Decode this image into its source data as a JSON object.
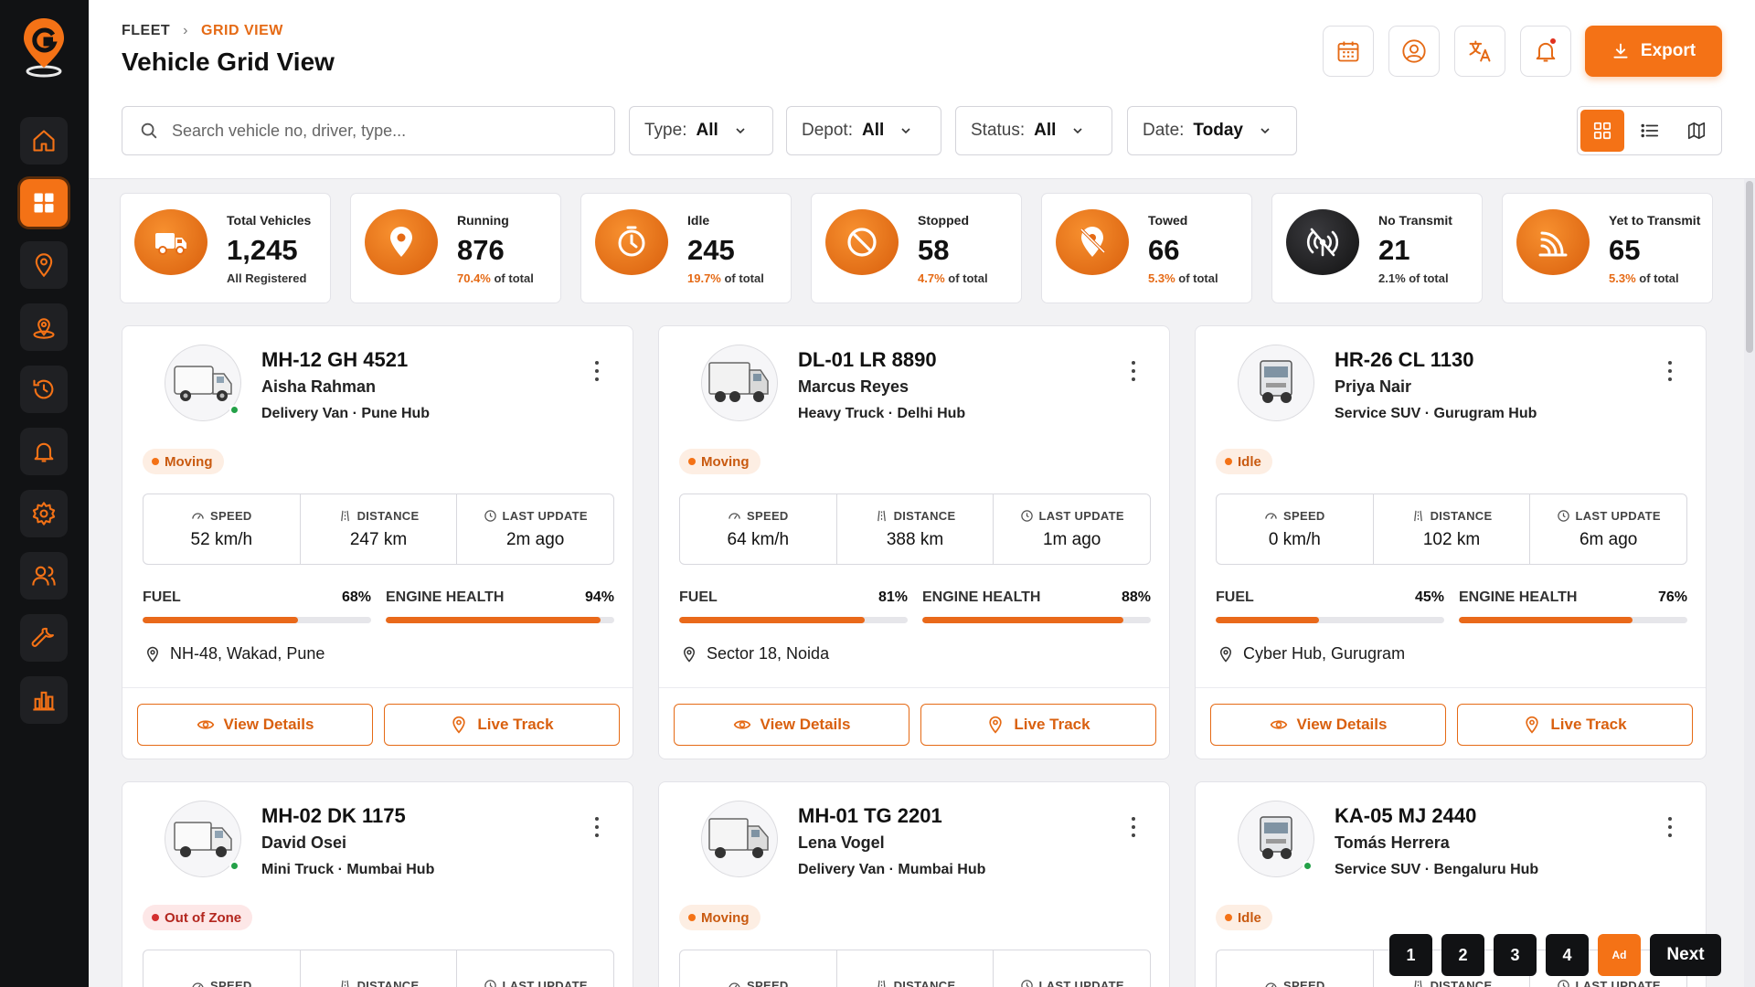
{
  "breadcrumb": {
    "root": "FLEET",
    "separator": "›",
    "current": "GRID VIEW"
  },
  "page": {
    "title": "Vehicle Grid View"
  },
  "header_actions": {
    "export_label": "Export"
  },
  "search": {
    "placeholder": "Search vehicle no, driver, type..."
  },
  "filters": [
    {
      "label": "Type:",
      "value": "All"
    },
    {
      "label": "Depot:",
      "value": "All"
    },
    {
      "label": "Status:",
      "value": "All"
    },
    {
      "label": "Date:",
      "value": "Today"
    }
  ],
  "colors": {
    "accent": "#f47216",
    "sidebar": "#111214",
    "moving": "#f47216",
    "out_of_zone": "#d32f2f",
    "online": "#24a148"
  },
  "stats": [
    {
      "label": "Total Vehicles",
      "value": "1,245",
      "pct": "",
      "sub": "All Registered",
      "icon": "truck-icon"
    },
    {
      "label": "Running",
      "value": "876",
      "pct": "70.4%",
      "sub": " of total",
      "icon": "location-pin-icon"
    },
    {
      "label": "Idle",
      "value": "245",
      "pct": "19.7%",
      "sub": " of total",
      "icon": "clock-icon"
    },
    {
      "label": "Stopped",
      "value": "58",
      "pct": "4.7%",
      "sub": " of total",
      "icon": "prohibited-icon"
    },
    {
      "label": "Towed",
      "value": "66",
      "pct": "5.3%",
      "sub": " of total",
      "icon": "pin-off-icon"
    },
    {
      "label": "No Transmit",
      "value": "21",
      "pct": "",
      "sub": "2.1% of total",
      "icon": "signal-off-icon"
    },
    {
      "label": "Yet to Transmit",
      "value": "65",
      "pct": "5.3%",
      "sub": " of total",
      "icon": "transmit-icon"
    }
  ],
  "labels": {
    "speed": "SPEED",
    "distance": "DISTANCE",
    "last_update": "LAST UPDATE",
    "fuel": "FUEL",
    "engine_health": "ENGINE HEALTH",
    "view_details": "View Details",
    "live_track": "Live Track"
  },
  "vehicles": [
    {
      "plate": "MH-12 GH 4521",
      "driver": "Aisha Rahman",
      "type_hub": "Delivery Van · Pune Hub",
      "status": "Moving",
      "speed": "52 km/h",
      "distance": "247 km",
      "last_update": "2m ago",
      "fuel": "68%",
      "fuel_pct": 68,
      "engine": "94%",
      "engine_pct": 94,
      "location": "NH-48, Wakad, Pune",
      "online": true
    },
    {
      "plate": "DL-01 LR 8890",
      "driver": "Marcus Reyes",
      "type_hub": "Heavy Truck · Delhi Hub",
      "status": "Moving",
      "speed": "64 km/h",
      "distance": "388 km",
      "last_update": "1m ago",
      "fuel": "81%",
      "fuel_pct": 81,
      "engine": "88%",
      "engine_pct": 88,
      "location": "Sector 18, Noida",
      "online": false
    },
    {
      "plate": "HR-26 CL 1130",
      "driver": "Priya Nair",
      "type_hub": "Service SUV · Gurugram Hub",
      "status": "Idle",
      "speed": "0 km/h",
      "distance": "102 km",
      "last_update": "6m ago",
      "fuel": "45%",
      "fuel_pct": 45,
      "engine": "76%",
      "engine_pct": 76,
      "location": "Cyber Hub, Gurugram",
      "online": false
    },
    {
      "plate": "MH-02 DK 1175",
      "driver": "David Osei",
      "type_hub": "Mini Truck · Mumbai Hub",
      "status": "Out of Zone",
      "online": true
    },
    {
      "plate": "MH-01 TG 2201",
      "driver": "Lena Vogel",
      "type_hub": "Delivery Van · Mumbai Hub",
      "status": "Moving",
      "online": false
    },
    {
      "plate": "KA-05 MJ 2440",
      "driver": "Tomás Herrera",
      "type_hub": "Service SUV · Bengaluru Hub",
      "status": "Idle",
      "online": true
    }
  ],
  "pagination": {
    "pages": [
      "1",
      "2",
      "3",
      "4"
    ],
    "current": "Ad",
    "next": "Next"
  }
}
